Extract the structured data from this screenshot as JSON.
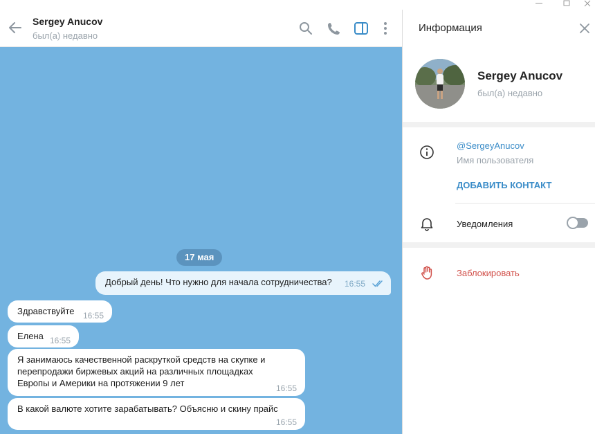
{
  "chat": {
    "name": "Sergey Anucov",
    "status": "был(а) недавно",
    "date_separator": "17 мая",
    "messages": [
      {
        "direction": "out",
        "text": "Добрый день! Что нужно для начала сотрудничества?",
        "time": "16:55",
        "read": true
      },
      {
        "direction": "in",
        "text": "Здравствуйте",
        "time": "16:55"
      },
      {
        "direction": "in",
        "text": "Елена",
        "time": "16:55"
      },
      {
        "direction": "in",
        "lines": [
          "Я занимаюсь качественной раскруткой средств на скупке и",
          "перепродажи биржевых акций на различных площадках",
          "Европы и Америки на протяжении 9 лет"
        ],
        "time": "16:55"
      },
      {
        "direction": "in",
        "text": "В какой валюте хотите зарабатывать? Объясню и скину прайс",
        "time": "16:55"
      }
    ]
  },
  "info_panel": {
    "title": "Информация",
    "profile": {
      "name": "Sergey Anucov",
      "status": "был(а) недавно"
    },
    "username": "@SergeyAnucov",
    "username_label": "Имя пользователя",
    "add_contact": "ДОБАВИТЬ КОНТАКТ",
    "notifications_label": "Уведомления",
    "notifications_enabled": false,
    "block_label": "Заблокировать"
  },
  "icons": [
    "back-arrow-icon",
    "search-icon",
    "phone-icon",
    "side-panel-icon",
    "more-vertical-icon",
    "close-icon",
    "info-icon",
    "bell-icon",
    "hand-icon"
  ],
  "colors": {
    "chat_background": "#73b3e0",
    "accent": "#3a8cc8",
    "danger": "#d1504a",
    "outgoing_bubble": "#e8f4fc"
  }
}
